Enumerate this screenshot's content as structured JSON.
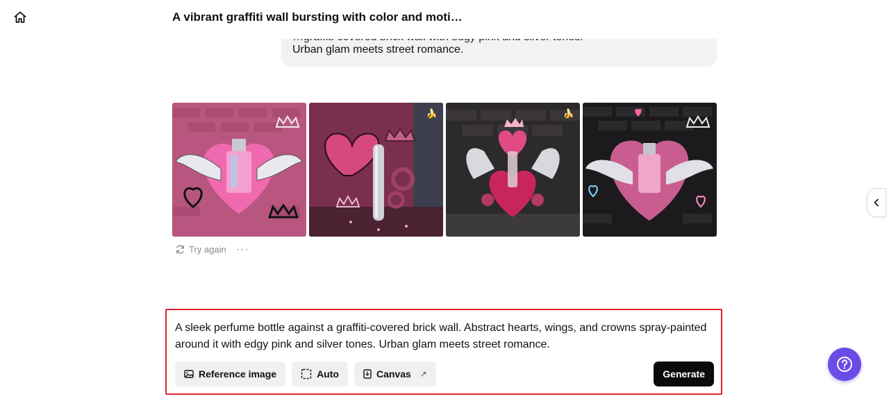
{
  "header": {
    "title": "A vibrant graffiti wall bursting with color and moti…",
    "home_icon": "home-icon"
  },
  "message": {
    "clipped_line": "…graffiti-covered brick wall with edgy pink and silver tones.",
    "visible_line": "Urban glam meets street romance."
  },
  "gallery": {
    "images": [
      {
        "description": "perfume-heart-wings-pink-brick",
        "badge": false
      },
      {
        "description": "silver-bottle-hearts-crowns-gears",
        "badge": true
      },
      {
        "description": "heart-wings-crown-dark-brick",
        "badge": true
      },
      {
        "description": "bottle-neon-heart-wings-black-brick",
        "badge": false
      }
    ],
    "badge_icon": "banana-icon"
  },
  "actions": {
    "try_again_label": "Try again",
    "more_label": "···"
  },
  "composer": {
    "prompt": "A sleek perfume bottle against a graffiti-covered brick wall. Abstract hearts, wings, and crowns spray-painted around it with edgy pink and silver tones. Urban glam meets street romance.",
    "tools": [
      {
        "label": "Reference image",
        "icon": "image-icon"
      },
      {
        "label": "Auto",
        "icon": "aspect-ratio-icon"
      },
      {
        "label": "Canvas",
        "icon": "canvas-icon",
        "external": "↗"
      }
    ],
    "generate_label": "Generate"
  },
  "colors": {
    "highlight_border": "#e0212b",
    "generate_bg": "#0b0b0b",
    "help_bg": "#6a4ce6",
    "bubble_bg": "#f2f2f2"
  }
}
